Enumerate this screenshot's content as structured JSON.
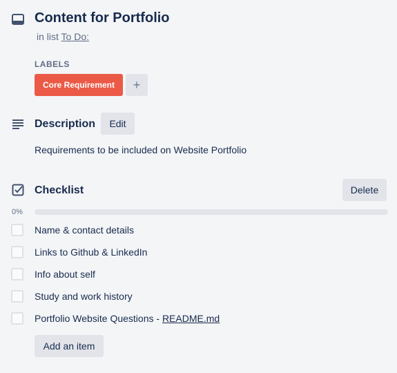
{
  "card": {
    "title": "Content for Portfolio",
    "in_list_prefix": "in list",
    "list_name": "To Do:"
  },
  "labels": {
    "heading": "LABELS",
    "items": [
      {
        "text": "Core Requirement",
        "color": "#eb5a46"
      }
    ],
    "add_symbol": "+"
  },
  "description": {
    "heading": "Description",
    "edit_label": "Edit",
    "text": "Requirements to be included on Website Portfolio"
  },
  "checklist": {
    "heading": "Checklist",
    "delete_label": "Delete",
    "progress_text": "0%",
    "progress": 0,
    "items": [
      {
        "text": "Name & contact details",
        "checked": false
      },
      {
        "text": "Links to Github & LinkedIn",
        "checked": false
      },
      {
        "text": "Info about self",
        "checked": false
      },
      {
        "text": "Study and work history",
        "checked": false
      },
      {
        "text": "Portfolio Website Questions - ",
        "link": "README.md",
        "checked": false
      }
    ],
    "add_item_label": "Add an item"
  },
  "icons": {
    "card": "card-icon",
    "description": "description-icon",
    "checklist": "checklist-icon"
  }
}
